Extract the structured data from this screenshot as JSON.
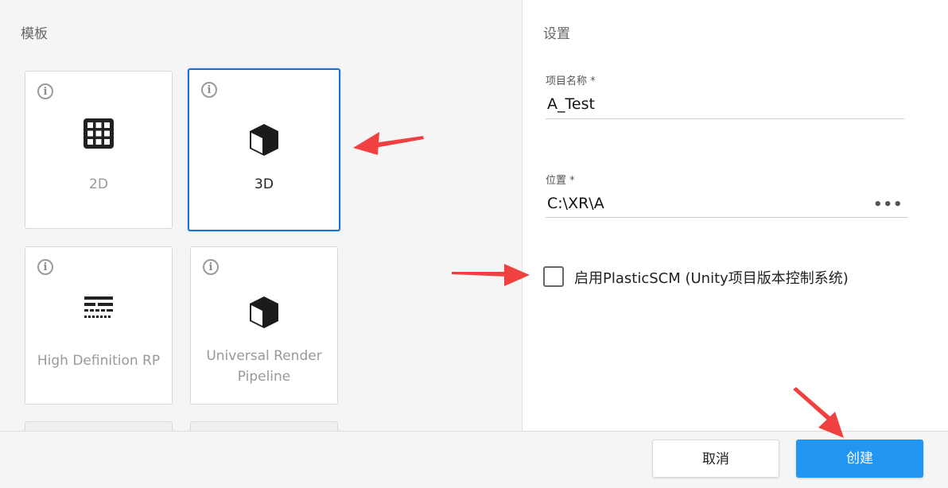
{
  "templates": {
    "title": "模板",
    "items": [
      {
        "label": "2D",
        "icon": "grid-icon",
        "selected": false
      },
      {
        "label": "3D",
        "icon": "cube-icon",
        "selected": true
      },
      {
        "label": "High Definition RP",
        "icon": "hdrp-icon",
        "selected": false
      },
      {
        "label_line1": "Universal Render",
        "label_line2": "Pipeline",
        "icon": "cube-icon",
        "selected": false
      }
    ]
  },
  "settings": {
    "title": "设置",
    "project_name": {
      "label": "项目名称 *",
      "value": "A_Test"
    },
    "location": {
      "label": "位置 *",
      "value": "C:\\XR\\A",
      "browse": "•••"
    },
    "plastic_scm": {
      "label": "启用PlasticSCM (Unity项目版本控制系统)",
      "checked": false
    }
  },
  "footer": {
    "cancel_label": "取消",
    "create_label": "创建"
  },
  "colors": {
    "accent": "#2196f3",
    "selected_border": "#1f6fd0",
    "annotation_arrow": "#f04040"
  }
}
